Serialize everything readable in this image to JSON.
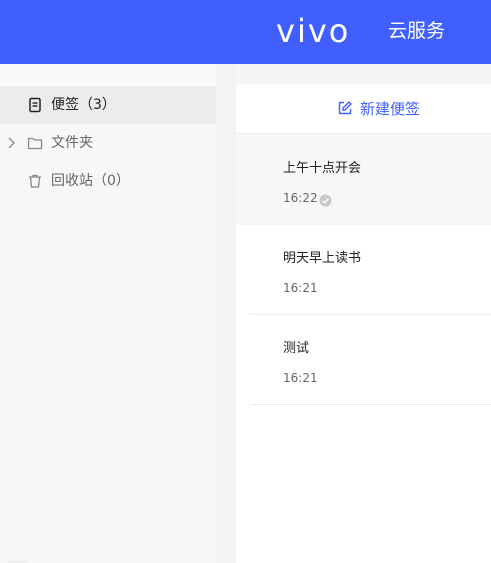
{
  "header": {
    "brand": "vivo",
    "service": "云服务",
    "bg_color": "#415fff"
  },
  "sidebar": {
    "items": [
      {
        "label": "便签（3）",
        "icon": "note-icon",
        "active": true
      },
      {
        "label": "文件夹",
        "icon": "folder-icon",
        "expand_icon": "chevron-right-icon",
        "active": false
      },
      {
        "label": "回收站（0）",
        "icon": "trash-icon",
        "active": false
      }
    ]
  },
  "notes_panel": {
    "new_label": "新建便签",
    "new_icon": "edit-icon",
    "accent": "#415fff",
    "notes": [
      {
        "title": "上午十点开会",
        "time": "16:22",
        "synced_icon": "check-circle-icon",
        "selected": true
      },
      {
        "title": "明天早上读书",
        "time": "16:21",
        "selected": false
      },
      {
        "title": "测试",
        "time": "16:21",
        "selected": false
      }
    ]
  }
}
